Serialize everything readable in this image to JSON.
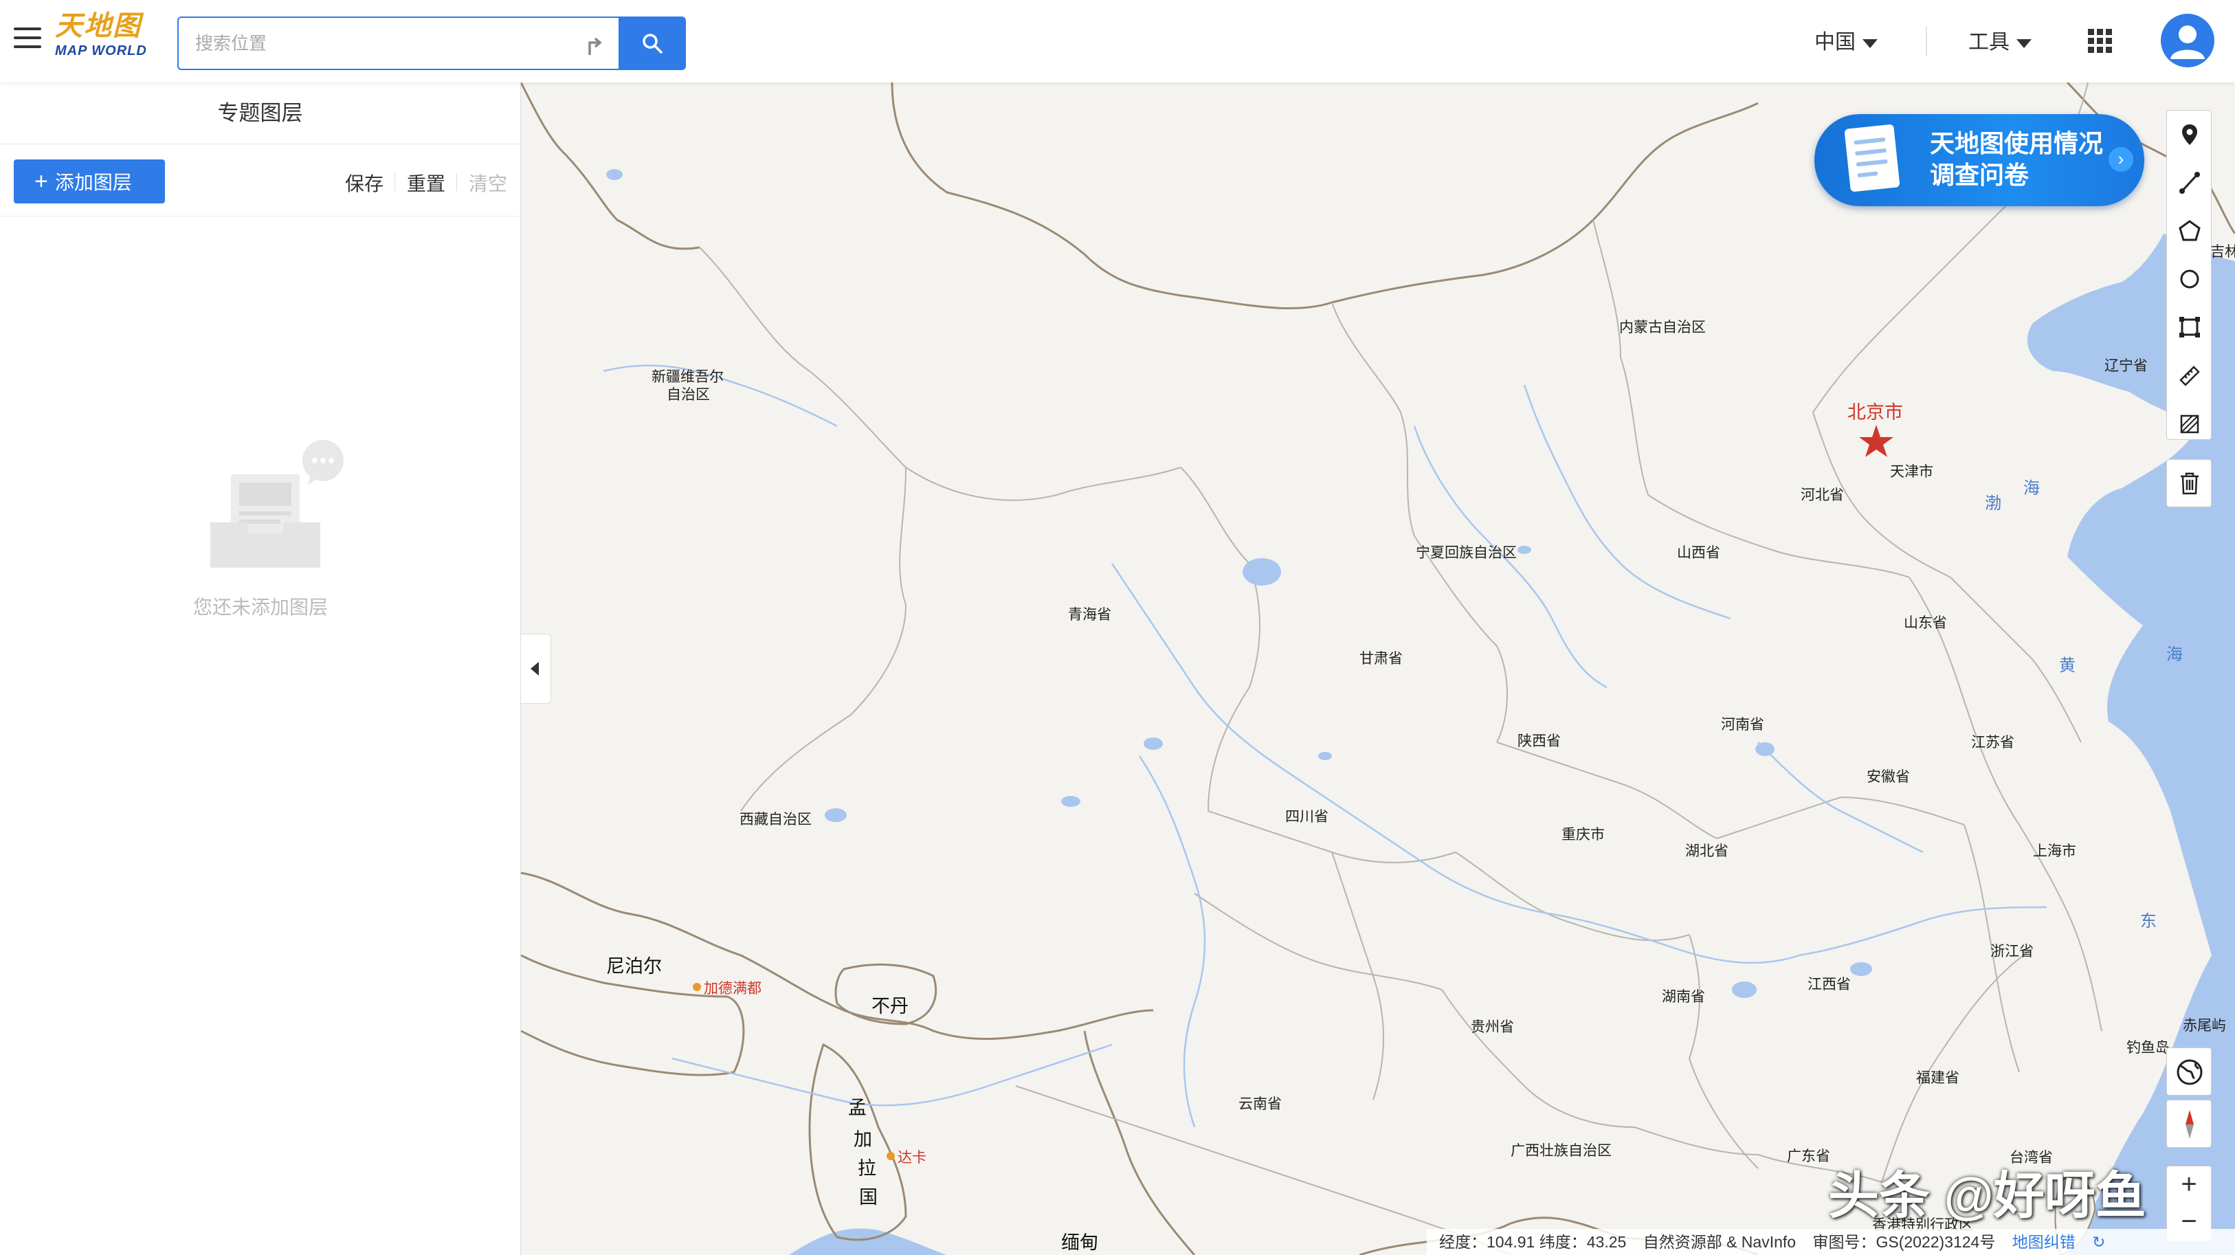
{
  "header": {
    "logo_cn": "天地图",
    "logo_en": "MAP WORLD",
    "search_placeholder": "搜索位置",
    "region": "中国",
    "tools": "工具"
  },
  "sidebar": {
    "title": "专题图层",
    "add_layer": "添加图层",
    "save": "保存",
    "reset": "重置",
    "clear": "清空",
    "empty_text": "您还未添加图层"
  },
  "survey": {
    "line1": "天地图使用情况",
    "line2": "调查问卷"
  },
  "map_labels": {
    "inner_mongolia": "内蒙古自治区",
    "xinjiang1": "新疆维吾尔",
    "xinjiang2": "自治区",
    "liaoning": "辽宁省",
    "jilin": "吉林",
    "beijing": "北京市",
    "tianjin": "天津市",
    "hebei": "河北省",
    "ningxia": "宁夏回族自治区",
    "shanxi": "山西省",
    "qinghai": "青海省",
    "gansu": "甘肃省",
    "shandong": "山东省",
    "henan": "河南省",
    "shaanxi": "陕西省",
    "jiangsu": "江苏省",
    "anhui": "安徽省",
    "tibet": "西藏自治区",
    "sichuan": "四川省",
    "chongqing": "重庆市",
    "hubei": "湖北省",
    "shanghai": "上海市",
    "nepal": "尼泊尔",
    "kathmandu": "加德满都",
    "bhutan": "不丹",
    "zhejiang": "浙江省",
    "jiangxi": "江西省",
    "hunan": "湖南省",
    "guizhou": "贵州省",
    "chiwei": "赤尾屿",
    "diaoyu": "钓鱼岛",
    "fujian": "福建省",
    "yunnan": "云南省",
    "guangxi": "广西壮族自治区",
    "guangdong": "广东省",
    "taiwan": "台湾省",
    "hongkong": "香港特别行政区",
    "bangla1": "孟",
    "bangla2": "加",
    "bangla3": "拉",
    "bangla4": "国",
    "dhaka": "达卡",
    "myanmar": "缅甸",
    "sea_bohai": "渤",
    "sea_hai": "海",
    "sea_huang": "黄",
    "sea_hai2": "海",
    "sea_dong": "东"
  },
  "status": {
    "coords": "经度：104.91 纬度：43.25",
    "source": "自然资源部 & NavInfo",
    "review": "审图号：GS(2022)3124号",
    "correction": "地图纠错"
  },
  "watermark": "头条 @好呀鱼",
  "colors": {
    "accent": "#2f7be8",
    "land": "#f4f3ef",
    "sea": "#a9c6ee",
    "capital": "#d0352b"
  }
}
